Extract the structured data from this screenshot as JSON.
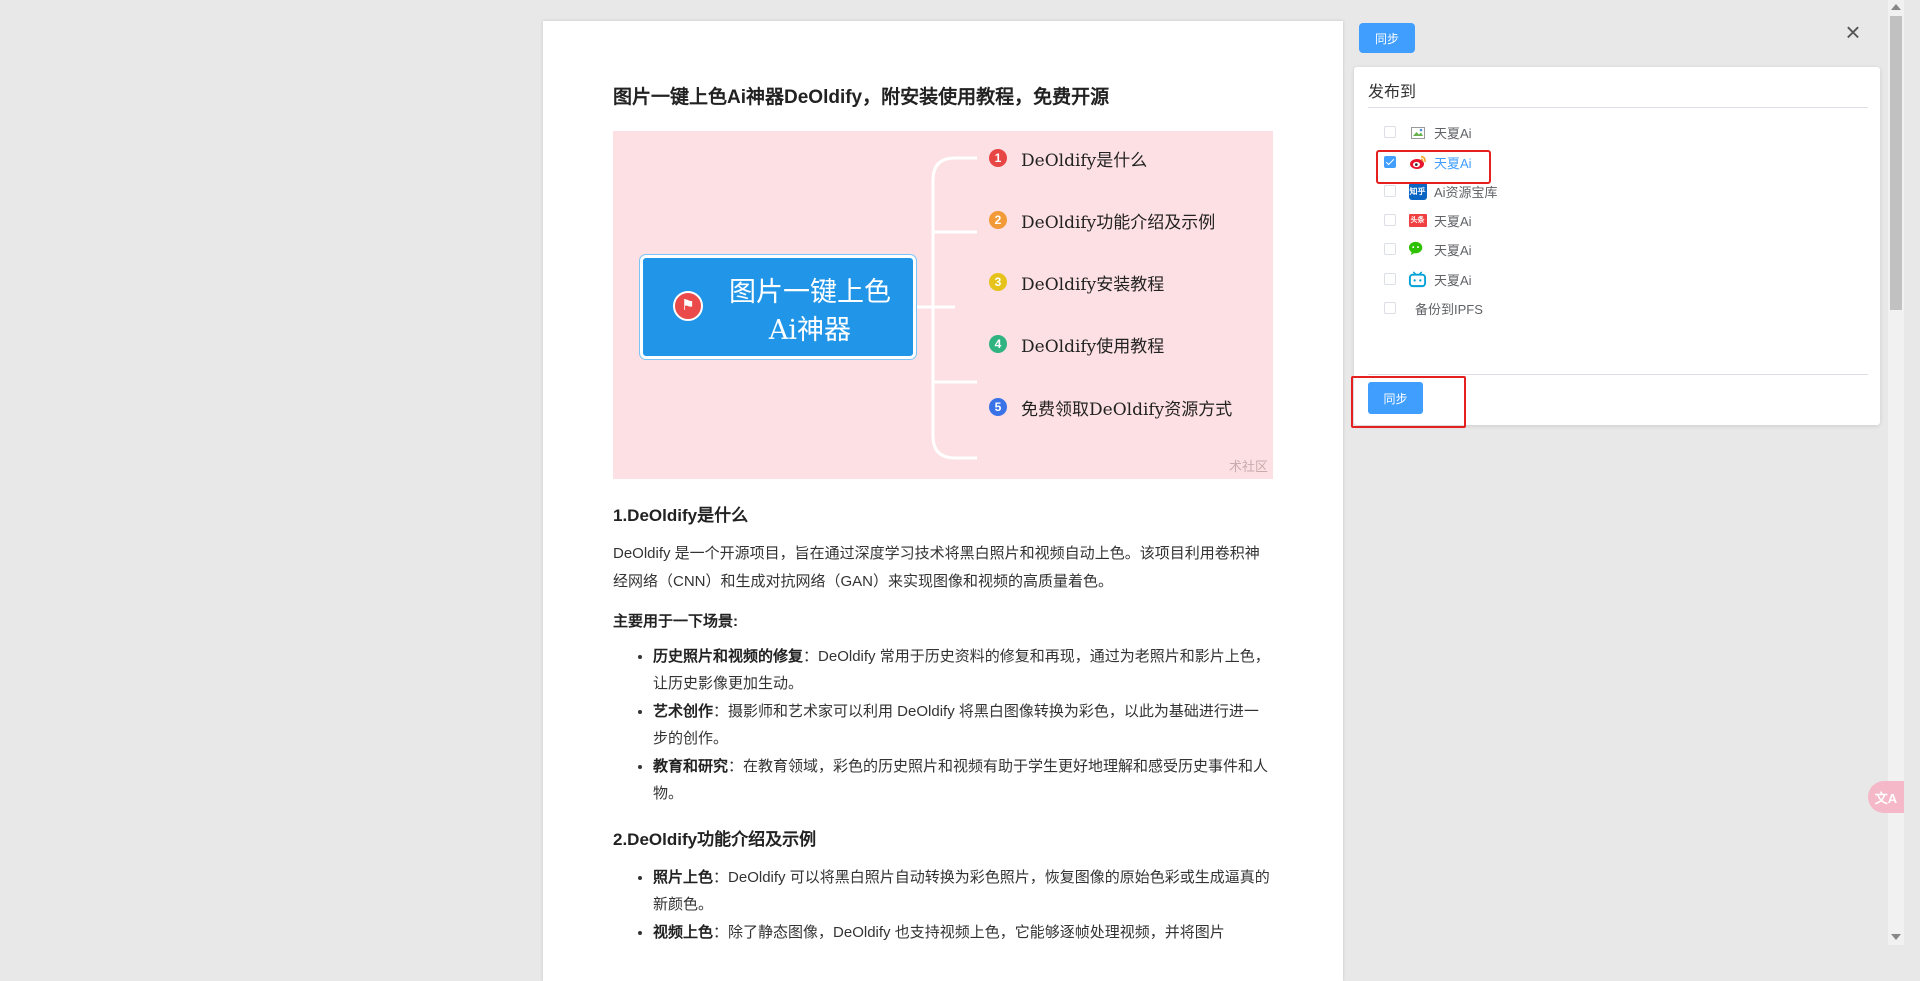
{
  "article": {
    "title": "图片一键上色Ai神器DeOldify，附安装使用教程，免费开源",
    "mindmap": {
      "center": "图片一键上色Ai神器",
      "items": [
        {
          "num": "1",
          "label": "DeOldify是什么",
          "color": "#e84545"
        },
        {
          "num": "2",
          "label": "DeOldify功能介绍及示例",
          "color": "#f29a38"
        },
        {
          "num": "3",
          "label": "DeOldify安装教程",
          "color": "#e6c31a"
        },
        {
          "num": "4",
          "label": "DeOldify使用教程",
          "color": "#2fb381"
        },
        {
          "num": "5",
          "label": "免费领取DeOldify资源方式",
          "color": "#3a73e8"
        }
      ],
      "watermark": "术社区",
      "background": "#fde0e3",
      "center_color": "#2196e8"
    },
    "section1_heading": "1.DeOldify是什么",
    "section1_para": "DeOldify 是一个开源项目，旨在通过深度学习技术将黑白照片和视频自动上色。该项目利用卷积神经网络（CNN）和生成对抗网络（GAN）来实现图像和视频的高质量着色。",
    "scenes_heading": "主要用于一下场景:",
    "scenes": [
      {
        "bold": "历史照片和视频的修复",
        "text": "：DeOldify 常用于历史资料的修复和再现，通过为老照片和影片上色，让历史影像更加生动。"
      },
      {
        "bold": "艺术创作",
        "text": "：摄影师和艺术家可以利用 DeOldify 将黑白图像转换为彩色，以此为基础进行进一步的创作。"
      },
      {
        "bold": "教育和研究",
        "text": "：在教育领域，彩色的历史照片和视频有助于学生更好地理解和感受历史事件和人物。"
      }
    ],
    "section2_heading": "2.DeOldify功能介绍及示例",
    "features": [
      {
        "bold": "照片上色",
        "text": "：DeOldify 可以将黑白照片自动转换为彩色照片，恢复图像的原始色彩或生成逼真的新颜色。"
      },
      {
        "bold": "视频上色",
        "text": "：除了静态图像，DeOldify 也支持视频上色，它能够逐帧处理视频，并将图片"
      }
    ]
  },
  "publish": {
    "sync_top_label": "同步",
    "header": "发布到",
    "options": [
      {
        "label": "天夏Ai",
        "icon": "broken-image-icon",
        "checked": false
      },
      {
        "label": "天夏Ai",
        "icon": "weibo-icon",
        "checked": true
      },
      {
        "label": "Ai资源宝库",
        "icon": "zhihu-icon",
        "icon_text": "知乎",
        "checked": false
      },
      {
        "label": "天夏Ai",
        "icon": "toutiao-icon",
        "icon_text": "头条",
        "checked": false
      },
      {
        "label": "天夏Ai",
        "icon": "wechat-icon",
        "checked": false
      },
      {
        "label": "天夏Ai",
        "icon": "bilibili-icon",
        "checked": false
      },
      {
        "label": "备份到IPFS",
        "icon": "",
        "checked": false
      }
    ],
    "sync_bottom_label": "同步",
    "accent": "#409eff",
    "highlight": "#e52020"
  },
  "overlay": {
    "close_symbol": "×",
    "translate_label": "文A"
  }
}
